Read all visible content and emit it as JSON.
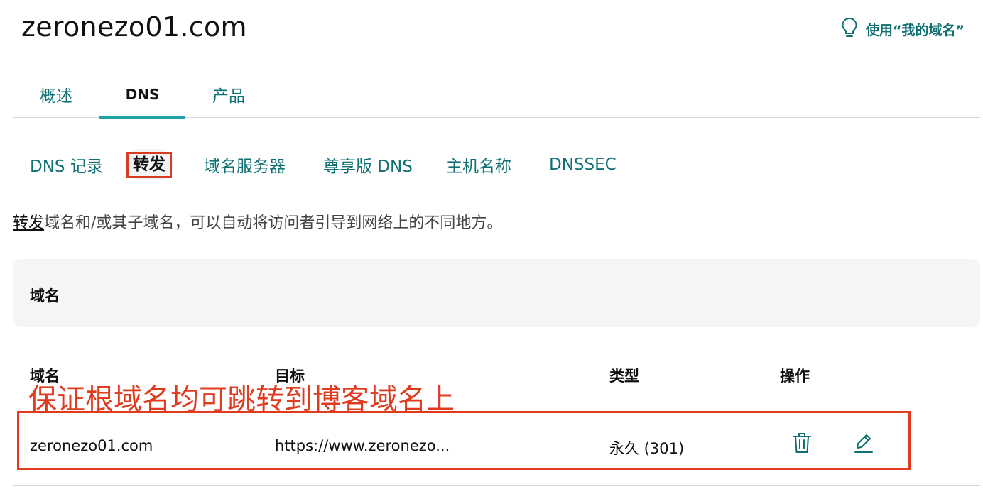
{
  "domain_title": "zeronezo01.com",
  "header_action": {
    "label": "使用“我的域名”",
    "icon": "lightbulb-icon"
  },
  "main_tabs": [
    {
      "label": "概述",
      "active": false
    },
    {
      "label": "DNS",
      "active": true
    },
    {
      "label": "产品",
      "active": false
    }
  ],
  "sub_tabs": [
    {
      "label": "DNS 记录",
      "active": false
    },
    {
      "label": "转发",
      "active": true
    },
    {
      "label": "域名服务器",
      "active": false
    },
    {
      "label": "尊享版 DNS",
      "active": false
    },
    {
      "label": "主机名称",
      "active": false
    },
    {
      "label": "DNSSEC",
      "active": false
    }
  ],
  "description": {
    "link": "转发",
    "text": "域名和/或其子域名，可以自动将访问者引导到网络上的不同地方。"
  },
  "panel_title": "域名",
  "table": {
    "headers": [
      "域名",
      "目标",
      "类型",
      "操作"
    ],
    "rows": [
      {
        "domain": "zeronezo01.com",
        "target": "https://www.zeronezo...",
        "type": "永久 (301)",
        "actions": [
          "trash-icon",
          "edit-pencil-icon"
        ]
      }
    ]
  },
  "annotation": "保证根域名均可跳转到博客域名上",
  "colors": {
    "teal": "#0f6f73",
    "tab_underline": "#1fa2a7",
    "annotation_red": "#e03a1f"
  }
}
